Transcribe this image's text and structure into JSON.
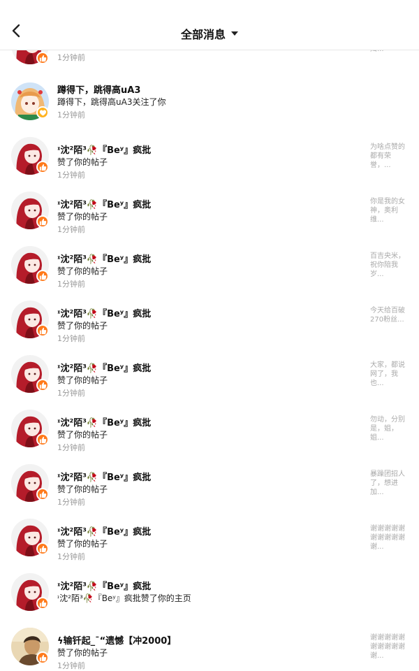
{
  "header": {
    "title": "全部消息"
  },
  "colors": {
    "badge_orange": "#ff7a1a",
    "time_gray": "#999999",
    "preview_gray": "#aaaaaa"
  },
  "icons": {
    "back": "chevron-left-icon",
    "dropdown": "caret-down-icon",
    "like_badge": "thumbs-up-icon",
    "follow_badge": "heart-icon"
  },
  "messages": [
    {
      "name": "",
      "action": "",
      "time": "1分钟前",
      "preview": "妇...",
      "badge": "thumbs-up"
    },
    {
      "name": "蹲得下，跳得高uA3",
      "action": "蹲得下，跳得高uA3关注了你",
      "time": "1分钟前",
      "preview": "",
      "badge": "heart"
    },
    {
      "name": "ᶦ沈²陌³🥀『Beʸ』疯批",
      "action": "赞了你的帖子",
      "time": "1分钟前",
      "preview": "为啥点赞的都有荣誉，...",
      "badge": "thumbs-up"
    },
    {
      "name": "ᶦ沈²陌³🥀『Beʸ』疯批",
      "action": "赞了你的帖子",
      "time": "1分钟前",
      "preview": "你是我的女神，奥利维...",
      "badge": "thumbs-up"
    },
    {
      "name": "ᶦ沈²陌³🥀『Beʸ』疯批",
      "action": "赞了你的帖子",
      "time": "1分钟前",
      "preview": "百吉央米，祝你陪我岁...",
      "badge": "thumbs-up"
    },
    {
      "name": "ᶦ沈²陌³🥀『Beʸ』疯批",
      "action": "赞了你的帖子",
      "time": "1分钟前",
      "preview": "今天给百破270粉丝...",
      "badge": "thumbs-up"
    },
    {
      "name": "ᶦ沈²陌³🥀『Beʸ』疯批",
      "action": "赞了你的帖子",
      "time": "1分钟前",
      "preview": "大家，都说网了，我也...",
      "badge": "thumbs-up"
    },
    {
      "name": "ᶦ沈²陌³🥀『Beʸ』疯批",
      "action": "赞了你的帖子",
      "time": "1分钟前",
      "preview": "勿动，分别是，姐，姐...",
      "badge": "thumbs-up"
    },
    {
      "name": "ᶦ沈²陌³🥀『Beʸ』疯批",
      "action": "赞了你的帖子",
      "time": "1分钟前",
      "preview": "暴躁团招人了，想进加...",
      "badge": "thumbs-up"
    },
    {
      "name": "ᶦ沈²陌³🥀『Beʸ』疯批",
      "action": "赞了你的帖子",
      "time": "1分钟前",
      "preview": "谢谢谢谢谢谢谢谢谢谢谢...",
      "badge": "thumbs-up"
    },
    {
      "name": "ᶦ沈²陌³🥀『Beʸ』疯批",
      "action": "ᶦ沈²陌³🥀『Beʸ』疯批赞了你的主页",
      "time": "",
      "preview": "",
      "badge": "thumbs-up"
    },
    {
      "name": "ϟ输钎起_ˉ“遗憾【冲2000】",
      "action": "赞了你的帖子",
      "time": "1分钟前",
      "preview": "谢谢谢谢谢谢谢谢谢谢谢...",
      "badge": "thumbs-up"
    }
  ]
}
